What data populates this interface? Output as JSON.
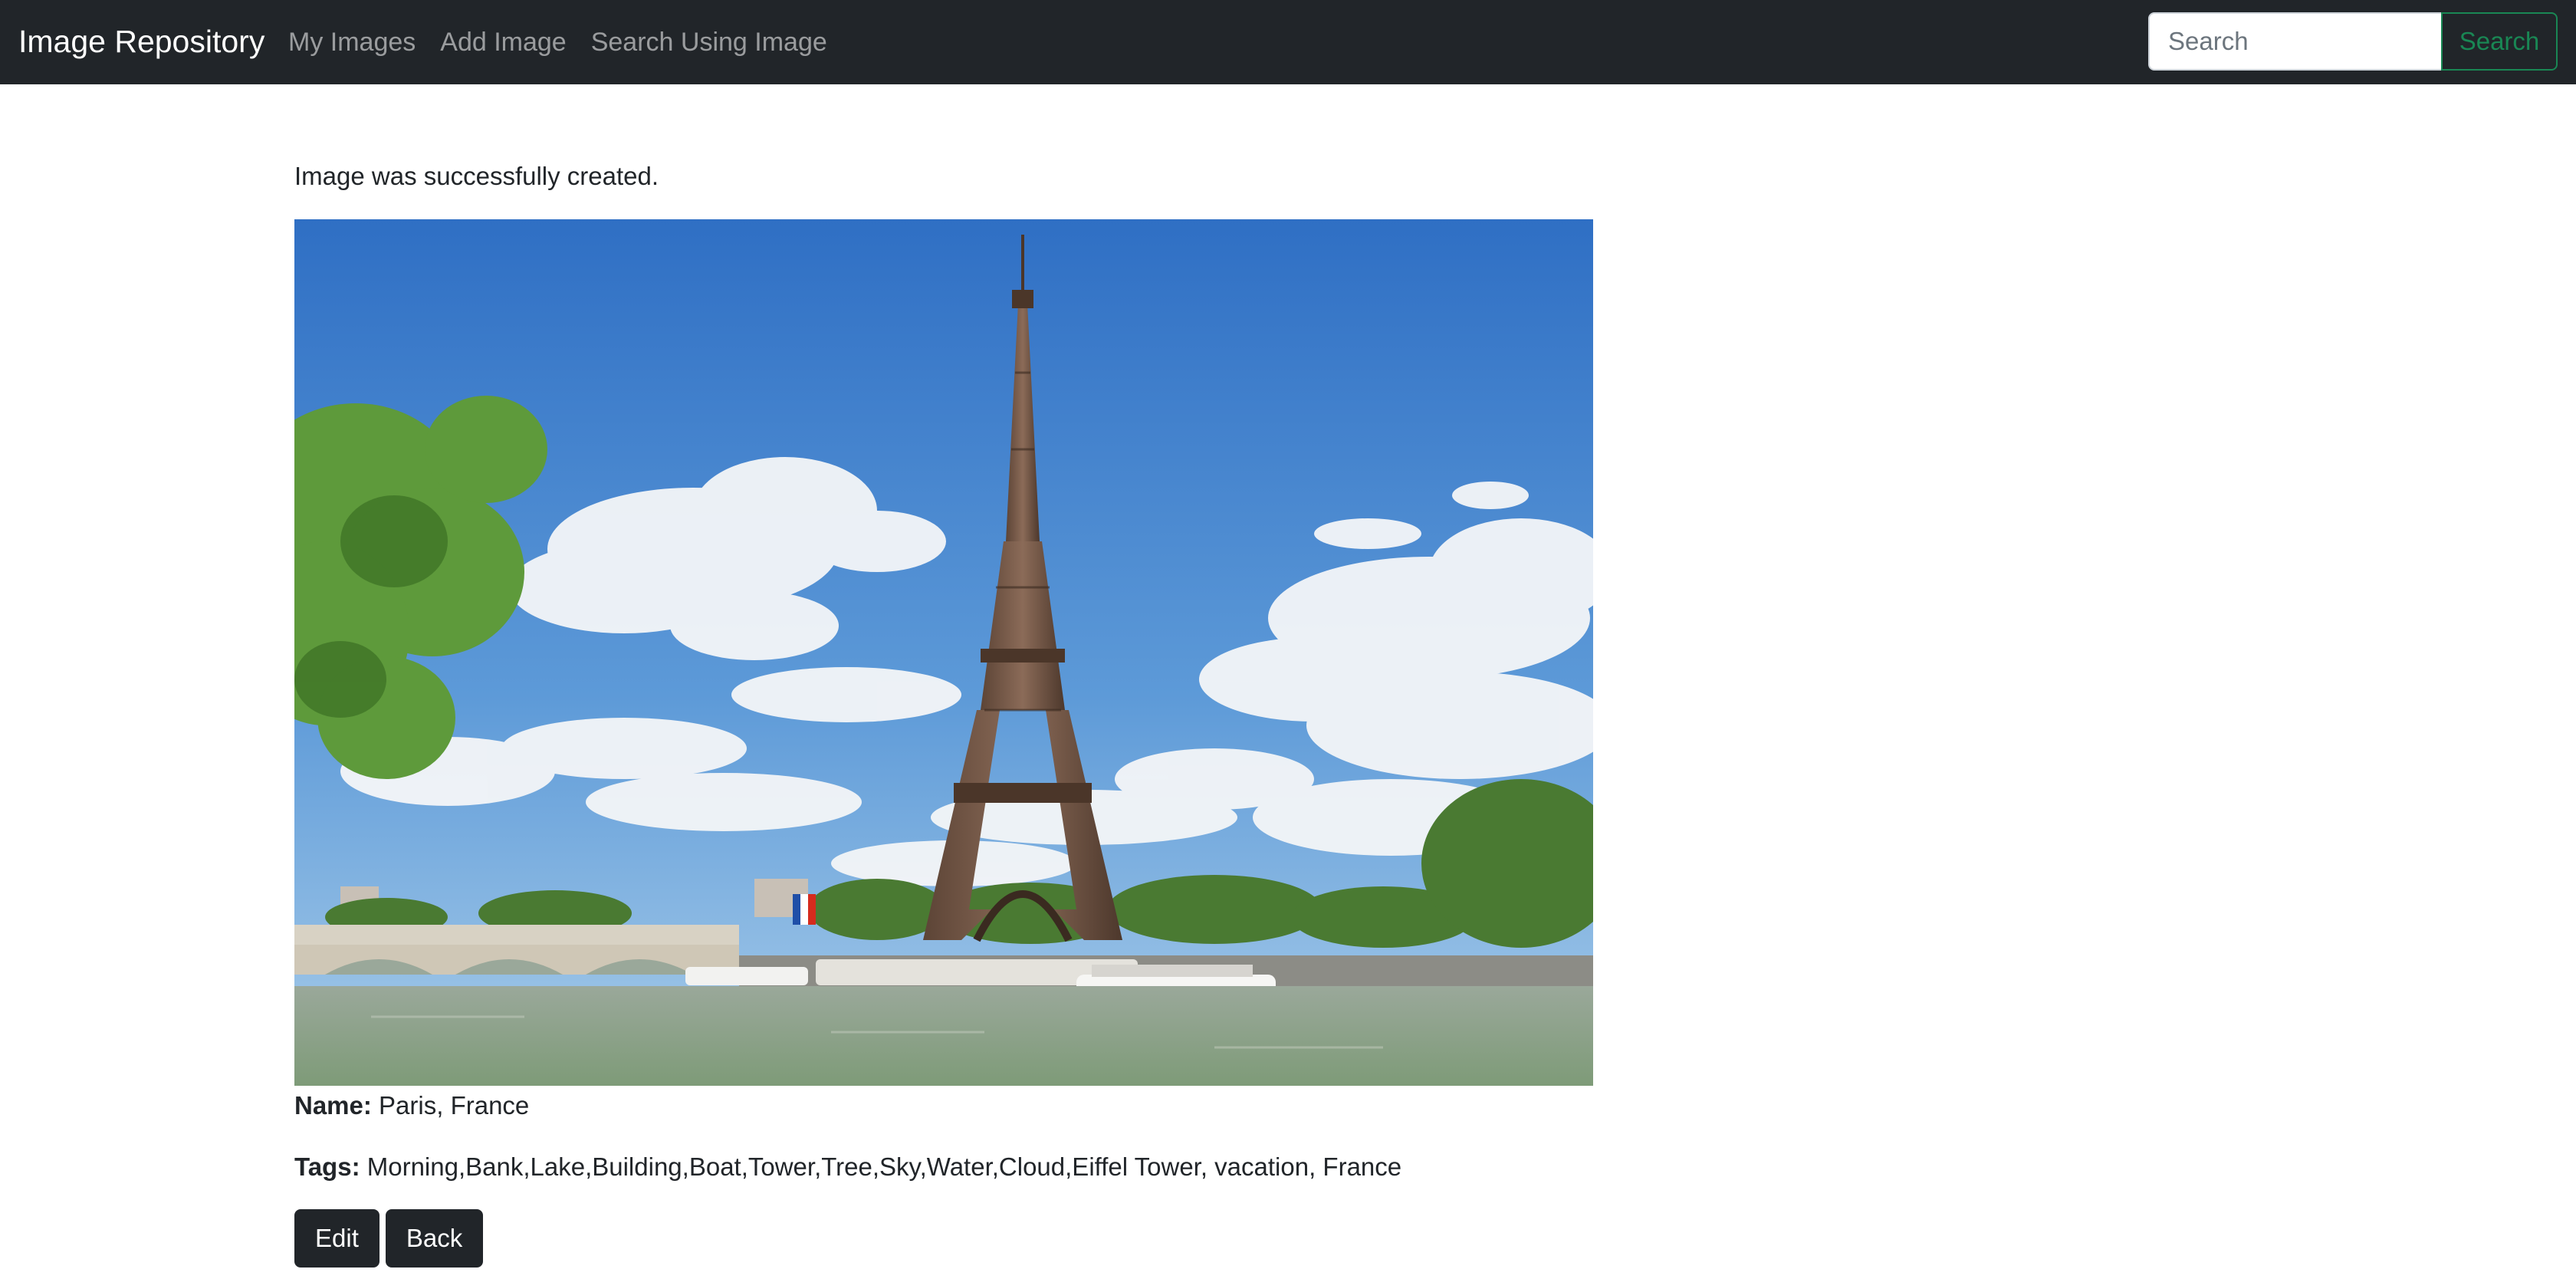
{
  "navbar": {
    "brand": "Image Repository",
    "links": [
      {
        "label": "My Images"
      },
      {
        "label": "Add Image"
      },
      {
        "label": "Search Using Image"
      }
    ],
    "search": {
      "placeholder": "Search",
      "value": "",
      "button_label": "Search"
    }
  },
  "notice": "Image was successfully created.",
  "image": {
    "alt": "Eiffel Tower over the Seine in Paris",
    "subject": "eiffel-tower-photo"
  },
  "details": {
    "name_label": "Name:",
    "name_value": "Paris, France",
    "tags_label": "Tags:",
    "tags_value": "Morning,Bank,Lake,Building,Boat,Tower,Tree,Sky,Water,Cloud,Eiffel Tower, vacation, France"
  },
  "actions": {
    "edit_label": "Edit",
    "back_label": "Back"
  },
  "colors": {
    "navbar_bg": "#212529",
    "success": "#198754",
    "button_bg": "#212529"
  }
}
